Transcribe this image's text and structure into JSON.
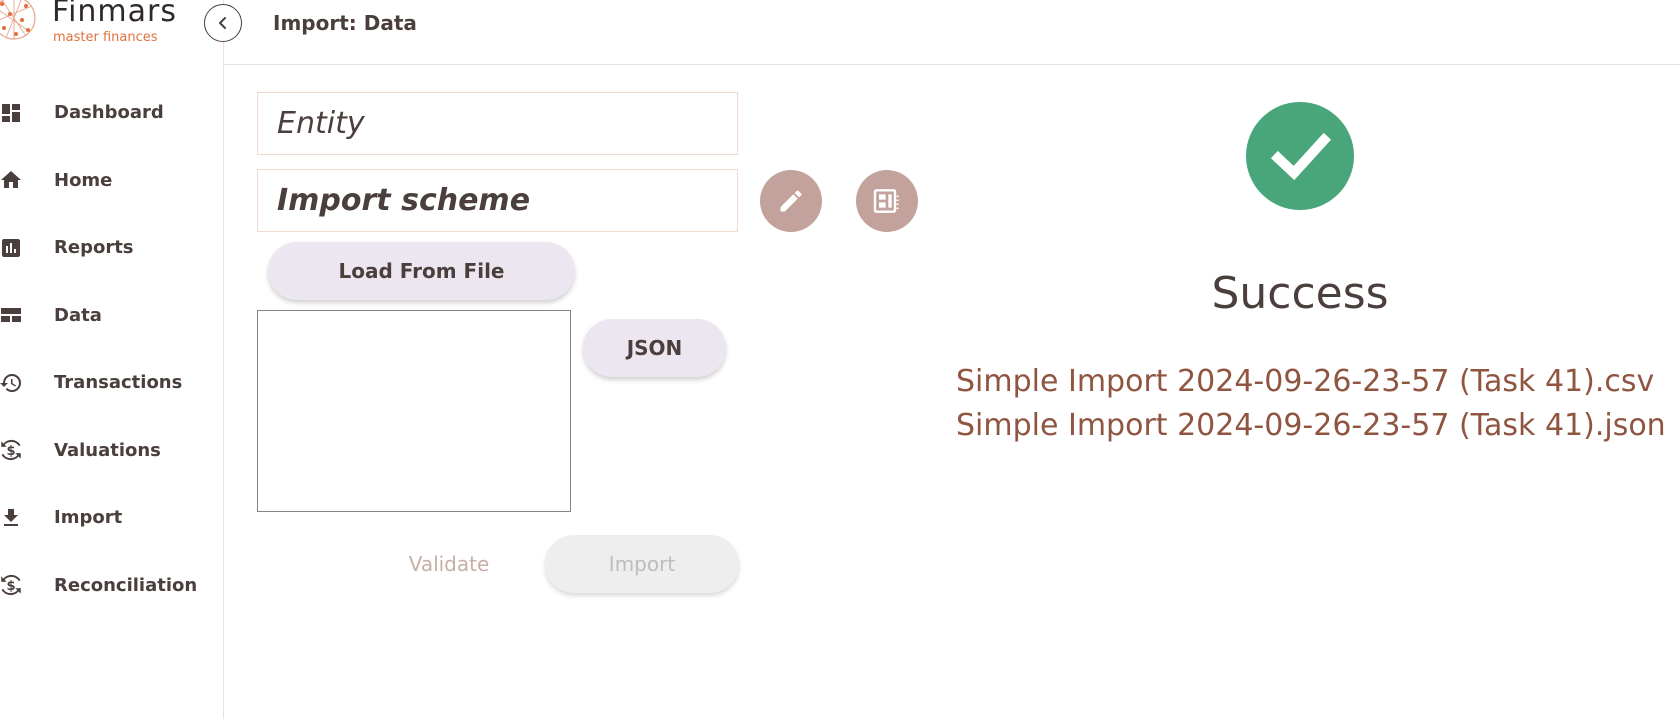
{
  "brand": {
    "name": "Finmars",
    "tagline": "master finances"
  },
  "header": {
    "title": "Import: Data"
  },
  "sidebar": {
    "items": [
      {
        "label": "Dashboard",
        "icon": "dashboard-icon"
      },
      {
        "label": "Home",
        "icon": "home-icon"
      },
      {
        "label": "Reports",
        "icon": "bar-chart-icon"
      },
      {
        "label": "Data",
        "icon": "table-icon"
      },
      {
        "label": "Transactions",
        "icon": "history-icon"
      },
      {
        "label": "Valuations",
        "icon": "currency-exchange-icon"
      },
      {
        "label": "Import",
        "icon": "download-icon"
      },
      {
        "label": "Reconciliation",
        "icon": "currency-exchange-icon"
      }
    ]
  },
  "form": {
    "entity_label": "Entity",
    "scheme_label": "Import scheme",
    "load_file_label": "Load From File",
    "json_label": "JSON",
    "validate_label": "Validate",
    "import_label": "Import"
  },
  "result": {
    "status": "Success",
    "files": [
      "Simple Import 2024-09-26-23-57 (Task 41).csv",
      "Simple Import 2024-09-26-23-57 (Task 41).json"
    ]
  },
  "colors": {
    "accent_orange": "#e2703c",
    "success_green": "#49a67b",
    "file_link_brown": "#8f5540",
    "round_button": "#c2a29a",
    "pill_button": "#ebe6ef"
  }
}
